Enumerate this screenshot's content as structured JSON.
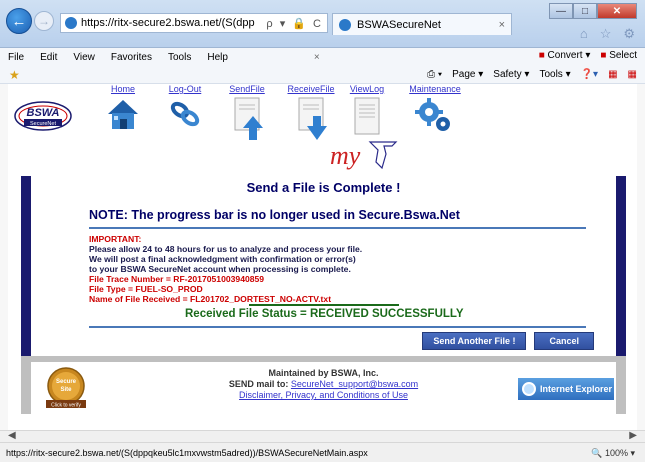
{
  "browser": {
    "url": "https://ritx-secure2.bswa.net/(S(dpp",
    "addr_tools": "ρ ▾ 🔒 C",
    "tab_title": "BSWASecureNet",
    "tab_close": "×",
    "status_url": "https://ritx-secure2.bswa.net/(S(dppqkeu5lc1mxvwstm5adred))/BSWASecureNetMain.aspx",
    "zoom": "100%"
  },
  "menu": {
    "items": [
      "File",
      "Edit",
      "View",
      "Favorites",
      "Tools",
      "Help"
    ],
    "x": "×",
    "convert": "Convert",
    "select": "Select"
  },
  "commandbar": {
    "page": "Page ▾",
    "safety": "Safety ▾",
    "tools": "Tools ▾"
  },
  "nav": {
    "items": [
      {
        "label": "Home",
        "icon": "house-icon"
      },
      {
        "label": "Log-Out",
        "icon": "chain-link-icon"
      },
      {
        "label": "SendFile",
        "icon": "upload-document-icon"
      },
      {
        "label": "ReceiveFile",
        "icon": "download-document-icon"
      },
      {
        "label": "ViewLog",
        "icon": "log-document-icon"
      },
      {
        "label": "Maintenance",
        "icon": "gears-icon"
      }
    ]
  },
  "logo": {
    "text": "BSWA",
    "subtext": "SecureNet"
  },
  "main": {
    "title": "Send a File is Complete !",
    "note": "NOTE: The progress bar is no longer used in Secure.Bswa.Net",
    "important_label": "IMPORTANT:",
    "message_lines": [
      "Please allow 24 to 48 hours for us to analyze and process your file.",
      "We will post a final acknowledgment with confirmation or error(s)",
      "to your BSWA SecureNet account when processing is complete."
    ],
    "trace_number": "File Trace Number = RF-2017051003940859",
    "file_type": "File Type = FUEL-SO_PROD",
    "file_name": "Name of File Received = FL201702_DORTEST_NO-ACTV.txt",
    "status": "Received File Status = RECEIVED SUCCESSFULLY",
    "send_another_label": "Send Another File !",
    "cancel_label": "Cancel"
  },
  "footer": {
    "maintained": "Maintained by BSWA, Inc.",
    "send_mail_prefix": "SEND mail to: ",
    "email": "SecureNet_support@bswa.com",
    "disclaimer": "Disclaimer, Privacy, and Conditions of Use",
    "badge_lines": [
      "Secure",
      "Site",
      "Click to verify"
    ],
    "ie_badge": "Internet Explorer"
  },
  "colors": {
    "frame": "#1a1a6e",
    "title_text": "#000066",
    "important_red": "#cc0000",
    "status_green": "#1a6a1a",
    "button_blue": "#3150a0"
  }
}
